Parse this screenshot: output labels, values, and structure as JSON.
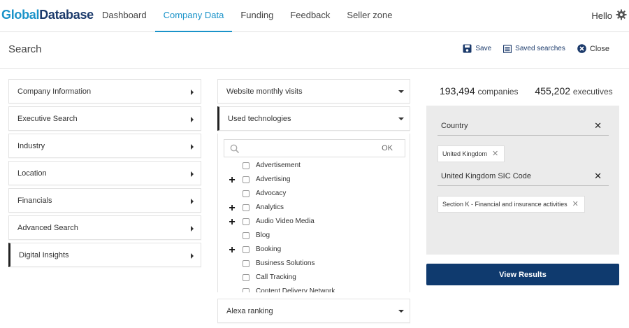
{
  "logo": {
    "part1": "Global",
    "part2": "Database"
  },
  "nav": [
    {
      "label": "Dashboard"
    },
    {
      "label": "Company Data"
    },
    {
      "label": "Funding"
    },
    {
      "label": "Feedback"
    },
    {
      "label": "Seller zone"
    }
  ],
  "user": {
    "greeting": "Hello"
  },
  "search_header": {
    "title": "Search",
    "save_label": "Save",
    "saved_searches_label": "Saved searches",
    "close_label": "Close"
  },
  "categories": [
    {
      "label": "Company Information"
    },
    {
      "label": "Executive Search"
    },
    {
      "label": "Industry"
    },
    {
      "label": "Location"
    },
    {
      "label": "Financials"
    },
    {
      "label": "Advanced Search"
    },
    {
      "label": "Digital Insights"
    }
  ],
  "digital": {
    "website_visits": "Website monthly visits",
    "used_technologies": "Used technologies",
    "alexa": "Alexa ranking",
    "search_placeholder": "",
    "ok_label": "OK",
    "technologies": [
      {
        "label": "Advertisement",
        "expandable": false
      },
      {
        "label": "Advertising",
        "expandable": true
      },
      {
        "label": "Advocacy",
        "expandable": false
      },
      {
        "label": "Analytics",
        "expandable": true
      },
      {
        "label": "Audio Video Media",
        "expandable": true
      },
      {
        "label": "Blog",
        "expandable": false
      },
      {
        "label": "Booking",
        "expandable": true
      },
      {
        "label": "Business Solutions",
        "expandable": false
      },
      {
        "label": "Call Tracking",
        "expandable": false
      },
      {
        "label": "Content Delivery Network",
        "expandable": false
      }
    ]
  },
  "results": {
    "companies_count": "193,494",
    "companies_unit": "companies",
    "executives_count": "455,202",
    "executives_unit": "executives"
  },
  "filters": [
    {
      "label": "Country",
      "chip": "United Kingdom"
    },
    {
      "label": "United Kingdom SIC Code",
      "chip": "Section K - Financial and insurance activities"
    }
  ],
  "view_results_label": "View Results",
  "colors": {
    "brand_light": "#1a93c9",
    "brand_dark": "#1b3a6b",
    "button": "#0f3a6e"
  }
}
